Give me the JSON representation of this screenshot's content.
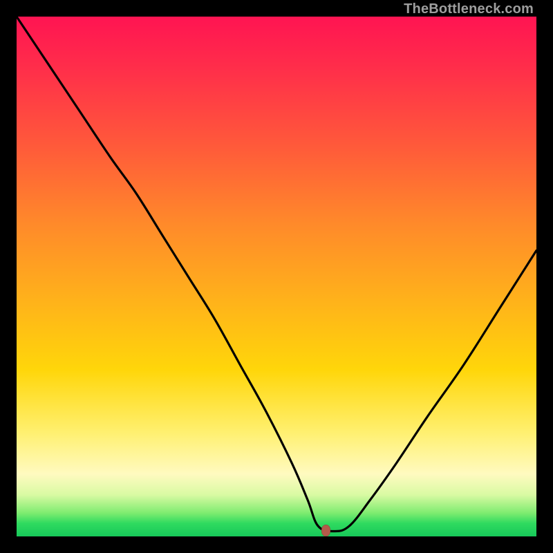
{
  "watermark": "TheBottleneck.com",
  "marker": {
    "x_pct": 59.5,
    "y_pct": 98.9
  },
  "chart_data": {
    "type": "line",
    "title": "",
    "xlabel": "",
    "ylabel": "",
    "xlim": [
      0,
      100
    ],
    "ylim": [
      0,
      100
    ],
    "x": [
      0,
      6,
      12,
      18,
      23,
      28,
      33,
      38,
      43,
      48,
      53,
      56,
      58,
      61,
      64,
      68,
      73,
      79,
      86,
      93,
      100
    ],
    "values": [
      100,
      91,
      82,
      73,
      66,
      58,
      50,
      42,
      33,
      24,
      14,
      7,
      2,
      1,
      2,
      7,
      14,
      23,
      33,
      44,
      55
    ],
    "flat_segment": {
      "x_start": 56,
      "x_end": 61,
      "y": 1
    },
    "marker_point": {
      "x": 59.5,
      "y": 1.1
    },
    "gradient_stops": [
      {
        "pct": 0,
        "color": "#ff1452"
      },
      {
        "pct": 10,
        "color": "#ff2e4a"
      },
      {
        "pct": 25,
        "color": "#ff5a3a"
      },
      {
        "pct": 40,
        "color": "#ff8a2a"
      },
      {
        "pct": 55,
        "color": "#ffb31a"
      },
      {
        "pct": 68,
        "color": "#ffd60a"
      },
      {
        "pct": 80,
        "color": "#fff070"
      },
      {
        "pct": 88,
        "color": "#fffac0"
      },
      {
        "pct": 92,
        "color": "#d9faa3"
      },
      {
        "pct": 95.5,
        "color": "#7eec70"
      },
      {
        "pct": 97.5,
        "color": "#2fda5f"
      },
      {
        "pct": 100,
        "color": "#17c95a"
      }
    ]
  }
}
